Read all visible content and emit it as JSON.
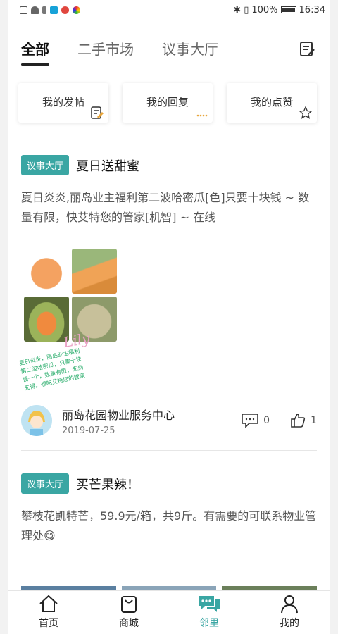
{
  "status_bar": {
    "battery": "100%",
    "time": "16:34"
  },
  "tabs": [
    {
      "label": "全部",
      "active": true
    },
    {
      "label": "二手市场",
      "active": false
    },
    {
      "label": "议事大厅",
      "active": false
    }
  ],
  "quick_buttons": [
    {
      "label": "我的发帖",
      "icon": "note-edit-icon"
    },
    {
      "label": "我的回复",
      "icon": "reply-dots-icon"
    },
    {
      "label": "我的点赞",
      "icon": "star-icon"
    }
  ],
  "posts": [
    {
      "tag": "议事大厅",
      "title": "夏日送甜蜜",
      "body": "夏日炎炎,丽岛业主福利第二波哈密瓜[色]只要十块钱 ~ 数量有限，快艾特您的管家[机智] ~ 在线",
      "image_caption": "夏日炎炎，丽岛业主福利\n第二波哈密瓜，只需十块\n钱一个，数量有限，先到\n先得。想吃艾特您的管家",
      "image_signature": "Lily",
      "author": "丽岛花园物业服务中心",
      "date": "2019-07-25",
      "comments": "0",
      "likes": "1"
    },
    {
      "tag": "议事大厅",
      "title": "买芒果辣！",
      "body": "攀枝花凯特芒，59.9元/箱，共9斤。有需要的可联系物业管理处😋"
    }
  ],
  "bottom_nav": [
    {
      "label": "首页",
      "icon": "home-icon",
      "active": false
    },
    {
      "label": "商城",
      "icon": "shopping-bag-icon",
      "active": false
    },
    {
      "label": "邻里",
      "icon": "chat-bubbles-icon",
      "active": true
    },
    {
      "label": "我的",
      "icon": "user-icon",
      "active": false
    }
  ],
  "colors": {
    "accent": "#3aa6a3",
    "tag_bg": "#3aa6a3",
    "text_primary": "#222222",
    "text_secondary": "#555555"
  }
}
